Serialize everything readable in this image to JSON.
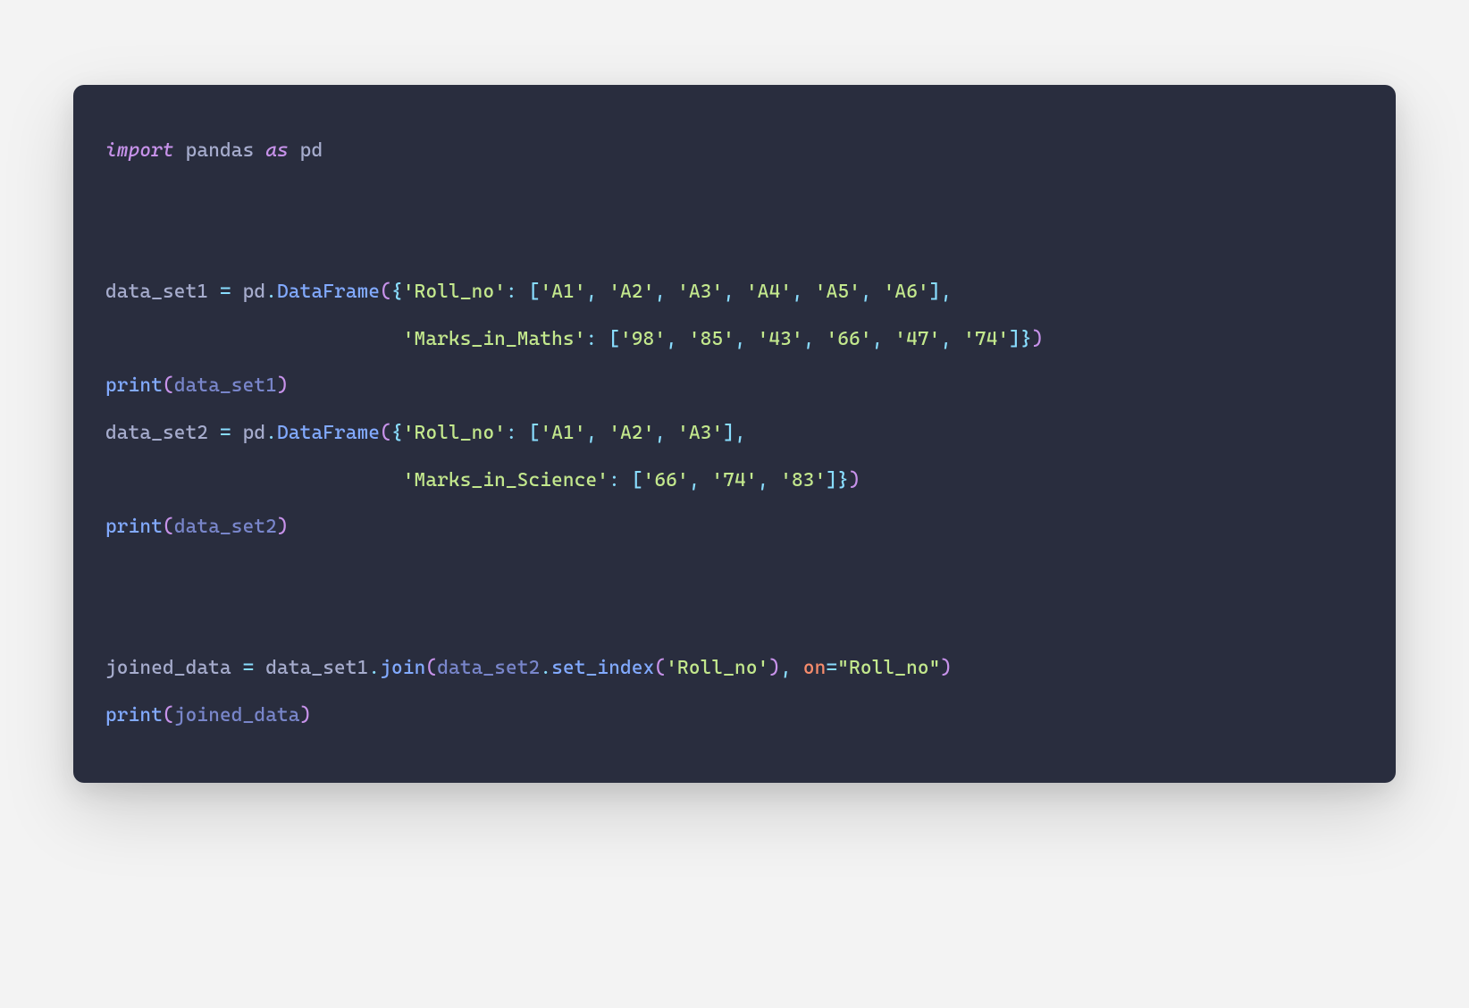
{
  "code": {
    "line1": {
      "import": "import",
      "module": "pandas",
      "as": "as",
      "alias": "pd"
    },
    "line2": {
      "var": "data_set1",
      "assign": "=",
      "module": "pd",
      "dot": ".",
      "fn": "DataFrame",
      "lparen": "(",
      "lbrace": "{",
      "key1": "'Roll_no'",
      "colon": ":",
      "lbracket": "[",
      "v1": "'A1'",
      "comma": ",",
      "v2": "'A2'",
      "v3": "'A3'",
      "v4": "'A4'",
      "v5": "'A5'",
      "v6": "'A6'",
      "rbracket": "]"
    },
    "line3": {
      "key2": "'Marks_in_Maths'",
      "colon": ":",
      "lbracket": "[",
      "v1": "'98'",
      "comma": ",",
      "v2": "'85'",
      "v3": "'43'",
      "v4": "'66'",
      "v5": "'47'",
      "v6": "'74'",
      "rbracket": "]",
      "rbrace": "}",
      "rparen": ")"
    },
    "line4": {
      "fn": "print",
      "lparen": "(",
      "arg": "data_set1",
      "rparen": ")"
    },
    "line5": {
      "var": "data_set2",
      "assign": "=",
      "module": "pd",
      "dot": ".",
      "fn": "DataFrame",
      "lparen": "(",
      "lbrace": "{",
      "key1": "'Roll_no'",
      "colon": ":",
      "lbracket": "[",
      "v1": "'A1'",
      "comma": ",",
      "v2": "'A2'",
      "v3": "'A3'",
      "rbracket": "]"
    },
    "line6": {
      "key2": "'Marks_in_Science'",
      "colon": ":",
      "lbracket": "[",
      "v1": "'66'",
      "comma": ",",
      "v2": "'74'",
      "v3": "'83'",
      "rbracket": "]",
      "rbrace": "}",
      "rparen": ")"
    },
    "line7": {
      "fn": "print",
      "lparen": "(",
      "arg": "data_set2",
      "rparen": ")"
    },
    "line8": {
      "var": "joined_data",
      "assign": "=",
      "obj": "data_set1",
      "dot": ".",
      "fn1": "join",
      "lparen1": "(",
      "obj2": "data_set2",
      "fn2": "set_index",
      "lparen2": "(",
      "arg1": "'Roll_no'",
      "rparen2": ")",
      "comma": ",",
      "param": "on",
      "eq": "=",
      "arg2": "\"Roll_no\"",
      "rparen1": ")"
    },
    "line9": {
      "fn": "print",
      "lparen": "(",
      "arg": "joined_data",
      "rparen": ")"
    }
  }
}
